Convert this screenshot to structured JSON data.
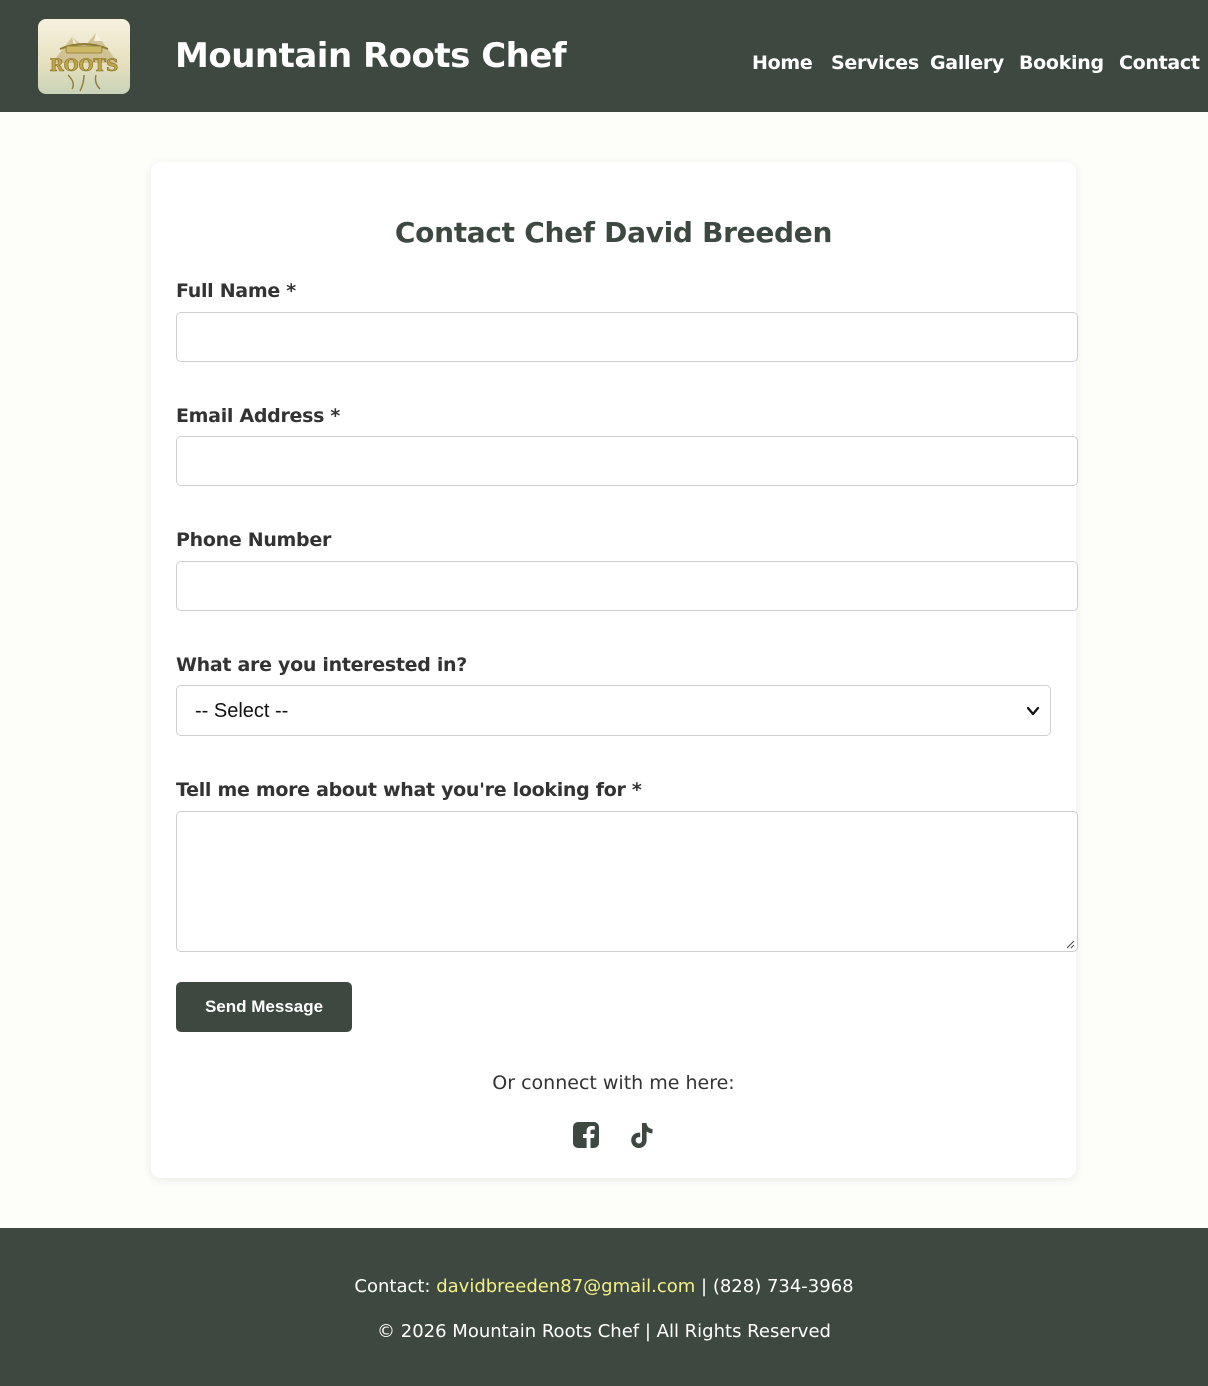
{
  "header": {
    "logo_text": "ROOTS",
    "site_title": "Mountain Roots Chef",
    "nav": [
      "Home",
      "Services",
      "Gallery",
      "Booking",
      "Contact"
    ]
  },
  "form": {
    "title": "Contact Chef David Breeden",
    "full_name": {
      "label": "Full Name *",
      "value": ""
    },
    "email": {
      "label": "Email Address *",
      "value": ""
    },
    "phone": {
      "label": "Phone Number",
      "value": ""
    },
    "interest": {
      "label": "What are you interested in?",
      "selected": "-- Select --"
    },
    "message": {
      "label": "Tell me more about what you're looking for *",
      "value": ""
    },
    "submit_label": "Send Message"
  },
  "connect": {
    "text": "Or connect with me here:",
    "icons": [
      "facebook-icon",
      "tiktok-icon"
    ]
  },
  "footer": {
    "contact_prefix": "Contact: ",
    "email": "davidbreeden87@gmail.com",
    "phone_sep": " | (828) 734-3968",
    "copyright": "© 2026 Mountain Roots Chef | All Rights Reserved"
  },
  "colors": {
    "header_bg": "#3d4940",
    "accent_link": "#f4ef87",
    "page_bg": "#fdfdf9"
  }
}
